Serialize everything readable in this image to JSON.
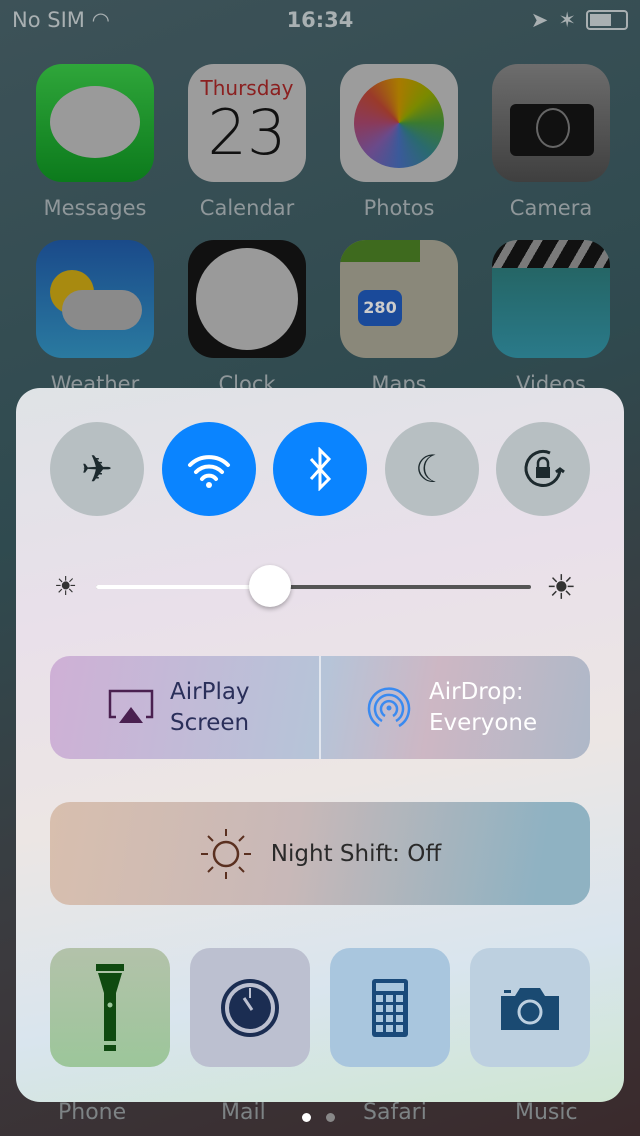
{
  "status_bar": {
    "carrier": "No SIM",
    "time": "16:34",
    "battery_level": 0.55
  },
  "home_apps": [
    {
      "label": "Messages",
      "icon": "messages-icon"
    },
    {
      "label": "Calendar",
      "icon": "calendar-icon",
      "day": "Thursday",
      "date": "23"
    },
    {
      "label": "Photos",
      "icon": "photos-icon"
    },
    {
      "label": "Camera",
      "icon": "camera-icon"
    },
    {
      "label": "Weather",
      "icon": "weather-icon"
    },
    {
      "label": "Clock",
      "icon": "clock-icon"
    },
    {
      "label": "Maps",
      "icon": "maps-icon",
      "shield": "280"
    },
    {
      "label": "Videos",
      "icon": "videos-icon"
    }
  ],
  "control_center": {
    "toggles": [
      {
        "name": "airplane-mode",
        "on": false
      },
      {
        "name": "wifi",
        "on": true
      },
      {
        "name": "bluetooth",
        "on": true
      },
      {
        "name": "do-not-disturb",
        "on": false
      },
      {
        "name": "rotation-lock",
        "on": false
      }
    ],
    "brightness": 0.4,
    "airplay": {
      "line1": "AirPlay",
      "line2": "Screen"
    },
    "airdrop": {
      "line1": "AirDrop:",
      "line2": "Everyone"
    },
    "night_shift": "Night Shift: Off",
    "shortcuts": [
      "flashlight",
      "timer",
      "calculator",
      "camera"
    ],
    "accent": "#0a84ff"
  },
  "dock": [
    "Phone",
    "Mail",
    "Safari",
    "Music"
  ],
  "page_dots": {
    "count": 2,
    "current": 1
  }
}
